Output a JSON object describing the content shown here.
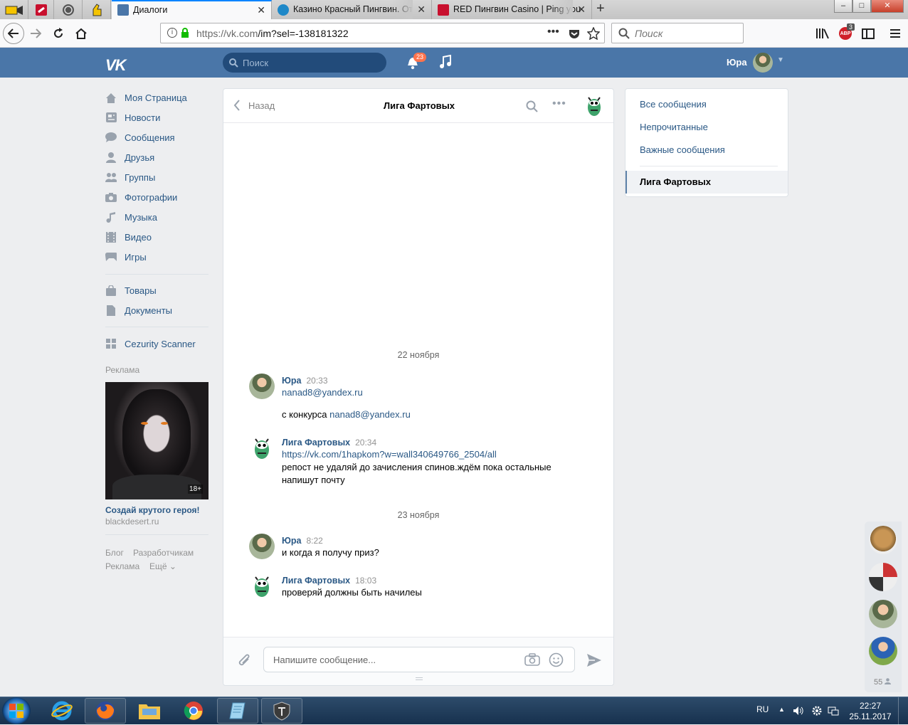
{
  "browser": {
    "tabs": [
      {
        "title": "Диалоги",
        "active": true
      },
      {
        "title": "Казино Красный Пингвин. От",
        "active": false
      },
      {
        "title": "RED Пингвин Casino | Ping you",
        "active": false
      }
    ],
    "new_tab": "+",
    "url_host": "https://vk.com",
    "url_path": "/im?sel=-138181322",
    "search_placeholder": "Поиск",
    "adblock_count": "3",
    "win_min": "–",
    "win_max": "□",
    "win_close": "✕"
  },
  "vk": {
    "logo": "VK",
    "search_placeholder": "Поиск",
    "notifications": "23",
    "user_name": "Юра"
  },
  "menu": {
    "items": [
      {
        "label": "Моя Страница",
        "icon": "home-icon"
      },
      {
        "label": "Новости",
        "icon": "news-icon"
      },
      {
        "label": "Сообщения",
        "icon": "messages-icon"
      },
      {
        "label": "Друзья",
        "icon": "friends-icon"
      },
      {
        "label": "Группы",
        "icon": "groups-icon"
      },
      {
        "label": "Фотографии",
        "icon": "camera-icon"
      },
      {
        "label": "Музыка",
        "icon": "music-icon"
      },
      {
        "label": "Видео",
        "icon": "video-icon"
      },
      {
        "label": "Игры",
        "icon": "gamepad-icon"
      },
      {
        "label": "Товары",
        "icon": "bag-icon"
      },
      {
        "label": "Документы",
        "icon": "document-icon"
      },
      {
        "label": "Cezurity Scanner",
        "icon": "apps-icon"
      }
    ],
    "ad_label": "Реклама",
    "ad_title": "Создай крутого героя!",
    "ad_domain": "blackdesert.ru",
    "ad_badge": "18+",
    "footer": [
      "Блог",
      "Разработчикам",
      "Реклама",
      "Ещё ⌄"
    ]
  },
  "chat": {
    "back": "Назад",
    "title": "Лига Фартовых",
    "dates": [
      "22 ноября",
      "23 ноября"
    ],
    "messages": [
      {
        "author": "Юра",
        "time": "20:33",
        "lines": [
          "nanad8@yandex.ru"
        ],
        "prefix2": "с конкурса ",
        "link2": "nanad8@yandex.ru"
      },
      {
        "author": "Лига Фартовых",
        "time": "20:34",
        "link": "https://vk.com/1hapkom?w=wall340649766_2504/all",
        "text": "репост не удаляй до зачисления спинов.ждём пока остальные напишут почту"
      },
      {
        "author": "Юра",
        "time": "8:22",
        "text": "и когда я получу приз?"
      },
      {
        "author": "Лига Фартовых",
        "time": "18:03",
        "text": "проверяй должны быть начилеы"
      }
    ],
    "input_placeholder": "Напишите сообщение..."
  },
  "filters": {
    "items": [
      "Все сообщения",
      "Непрочитанные",
      "Важные сообщения"
    ],
    "selected": "Лига Фартовых"
  },
  "rail": {
    "online_count": "55"
  },
  "taskbar": {
    "lang": "RU",
    "time": "22:27",
    "date": "25.11.2017"
  }
}
